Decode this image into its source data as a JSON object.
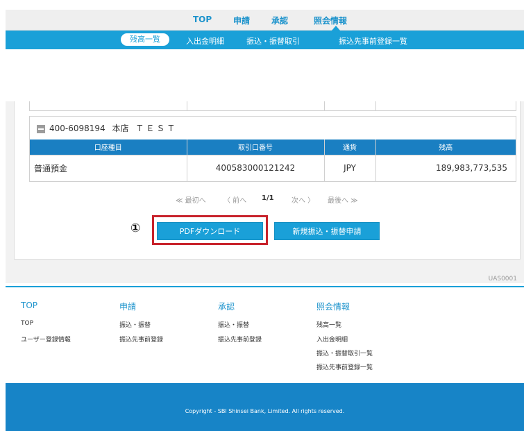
{
  "top_nav": {
    "items": [
      "TOP",
      "申請",
      "承認",
      "照会情報"
    ],
    "active": "照会情報"
  },
  "sub_nav": {
    "items": [
      "残高一覧",
      "入出金明細",
      "振込・振替取引",
      "振込先事前登録一覧"
    ],
    "active": "残高一覧"
  },
  "account": {
    "number": "400-6098194",
    "branch": "本店",
    "name": "ＴＥＳＴ",
    "table": {
      "headers": [
        "口座種目",
        "取引口番号",
        "通貨",
        "残高"
      ],
      "rows": [
        [
          "普通預金",
          "400583000121242",
          "JPY",
          "189,983,773,535"
        ]
      ]
    }
  },
  "pager": {
    "first": "≪ 最初へ",
    "prev": "〈 前へ",
    "current": "1/1",
    "next": "次へ 〉",
    "last": "最後へ ≫"
  },
  "buttons": {
    "pdf_download": "PDFダウンロード",
    "new_transfer": "新規振込・振替申請"
  },
  "annotation_number": "①",
  "screen_code": "UAS0001",
  "footer": {
    "columns": [
      {
        "title": "TOP",
        "links": [
          "TOP",
          "ユーザー登録情報"
        ]
      },
      {
        "title": "申請",
        "links": [
          "振込・振替",
          "振込先事前登録"
        ]
      },
      {
        "title": "承認",
        "links": [
          "振込・振替",
          "振込先事前登録"
        ]
      },
      {
        "title": "照会情報",
        "links": [
          "残高一覧",
          "入出金明細",
          "振込・振替取引一覧",
          "振込先事前登録一覧"
        ]
      }
    ],
    "copyright": "Copyright - SBI Shinsei Bank, Limited. All rights reserved."
  },
  "colors": {
    "brand": "#1aa0d8",
    "table_header": "#1a7fc2",
    "highlight": "#c8232c"
  }
}
